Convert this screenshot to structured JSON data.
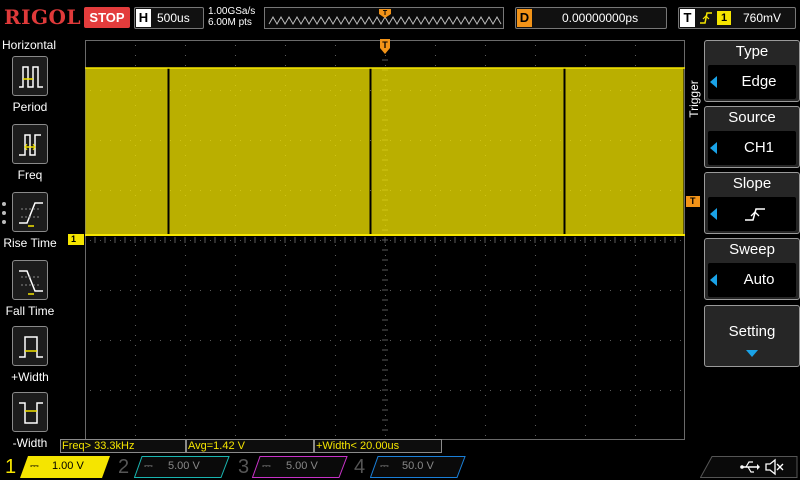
{
  "topbar": {
    "logo": "RIGOL",
    "run_state": "STOP",
    "timebase_tag": "H",
    "timebase": "500us",
    "sample_rate": "1.00GSa/s",
    "memory_depth": "6.00M pts",
    "delay_tag": "D",
    "delay": "0.00000000ps",
    "trigger_tag": "T",
    "trigger_channel": "1",
    "trigger_level": "760mV"
  },
  "left_menu": {
    "title": "Horizontal",
    "items": [
      {
        "label": "Period",
        "icon": "period-icon"
      },
      {
        "label": "Freq",
        "icon": "frequency-icon"
      },
      {
        "label": "Rise Time",
        "icon": "rise-time-icon"
      },
      {
        "label": "Fall Time",
        "icon": "fall-time-icon"
      },
      {
        "label": "+Width",
        "icon": "positive-width-icon"
      },
      {
        "label": "-Width",
        "icon": "negative-width-icon"
      }
    ]
  },
  "screen": {
    "ch1_marker": "1",
    "trigger_level_marker": "T",
    "trigger_position_marker": "T"
  },
  "measurements": [
    {
      "text": "Freq> 33.3kHz"
    },
    {
      "text": "Avg=1.42 V"
    },
    {
      "text": "+Width< 20.00us"
    }
  ],
  "right_menu": {
    "vertical_title": "Trigger",
    "items": [
      {
        "title": "Type",
        "value": "Edge"
      },
      {
        "title": "Source",
        "value": "CH1"
      },
      {
        "title": "Slope",
        "value": "rising-edge-icon"
      },
      {
        "title": "Sweep",
        "value": "Auto"
      }
    ],
    "setting": "Setting"
  },
  "channels": [
    {
      "num": "1",
      "volts": "1.00 V",
      "color": "#f5e500",
      "active": true
    },
    {
      "num": "2",
      "volts": "5.00 V",
      "color": "#19b5b0",
      "active": false
    },
    {
      "num": "3",
      "volts": "5.00 V",
      "color": "#c832c8",
      "active": false
    },
    {
      "num": "4",
      "volts": "50.0 V",
      "color": "#1a7fd8",
      "active": false
    }
  ],
  "colors": {
    "ch1": "#f5e500",
    "trigger": "#f29318",
    "stop": "#e33c3c",
    "accent": "#1aa3e8"
  }
}
